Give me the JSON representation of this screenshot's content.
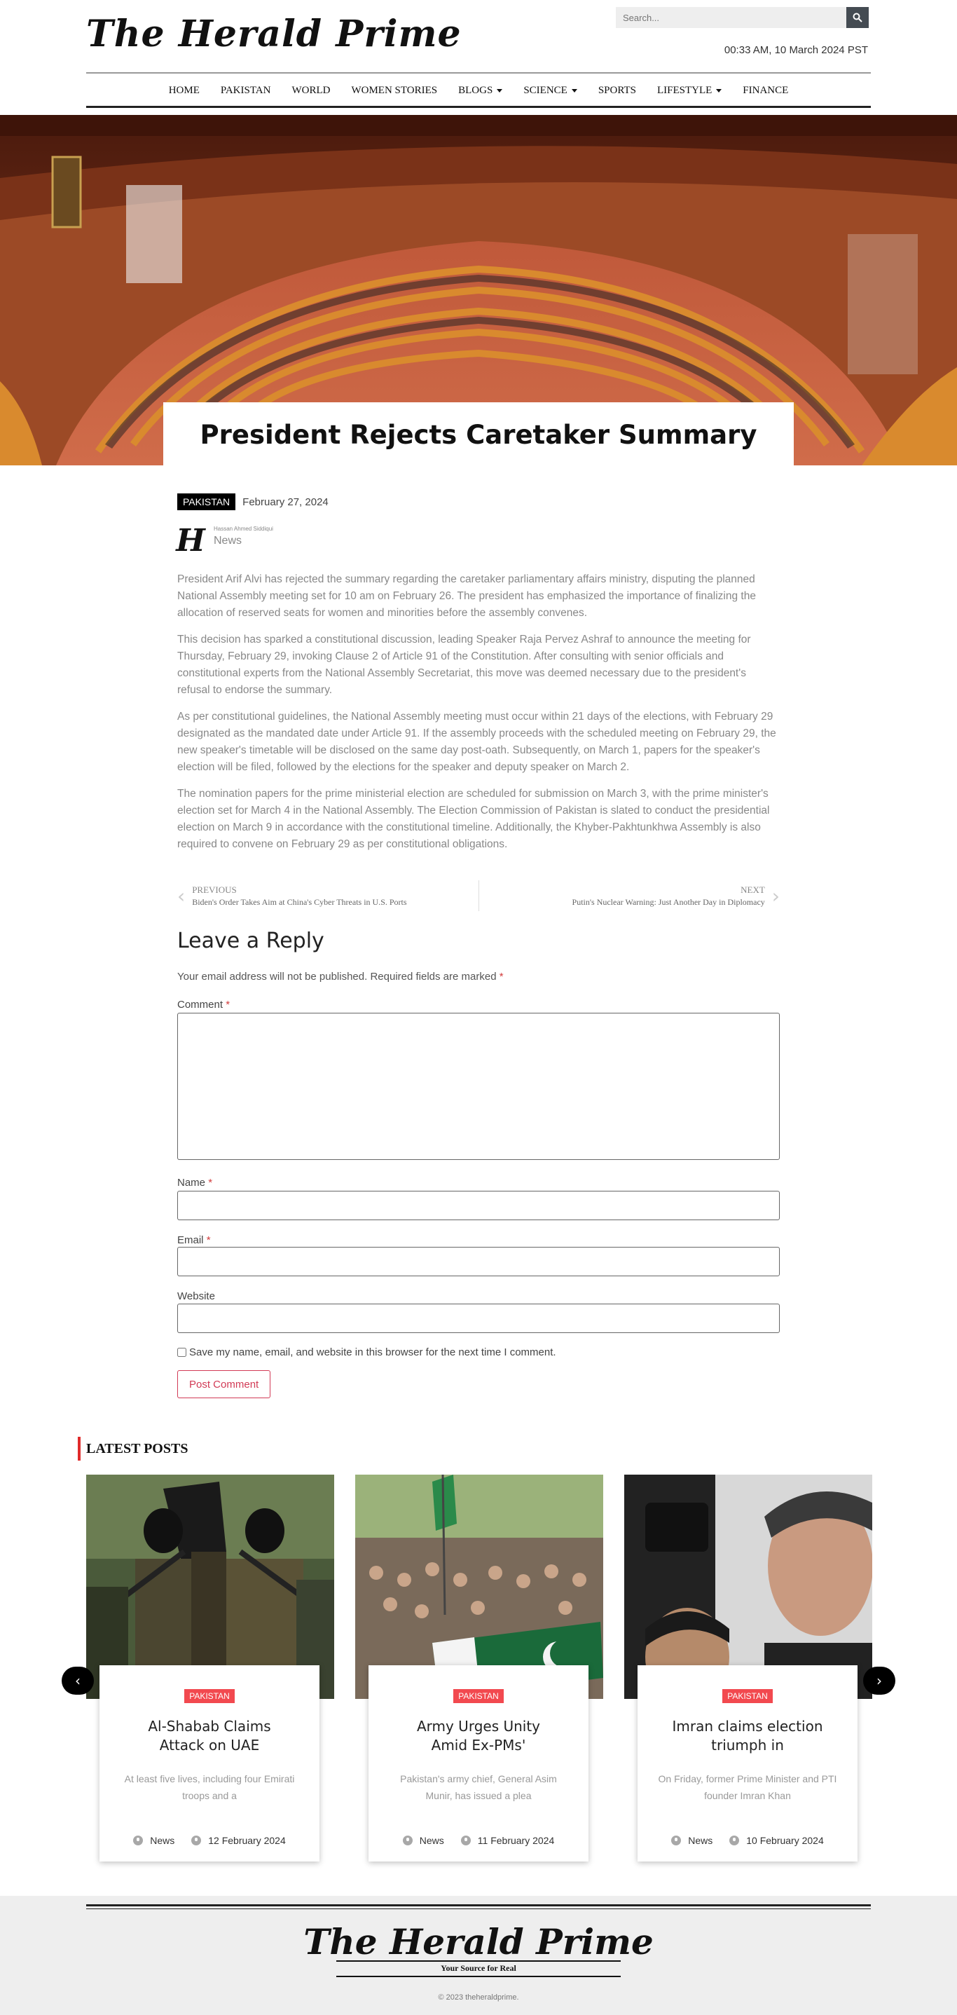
{
  "site": {
    "name": "The Herald Prime",
    "tagline": "Your Source for Real",
    "copyright": "© 2023 theheraldprime."
  },
  "header": {
    "search_placeholder": "Search...",
    "datetime": "00:33 AM, 10 March 2024 PST"
  },
  "nav": {
    "items": [
      {
        "label": "HOME"
      },
      {
        "label": "PAKISTAN"
      },
      {
        "label": "WORLD"
      },
      {
        "label": "WOMEN STORIES"
      },
      {
        "label": "BLOGS"
      },
      {
        "label": "SCIENCE"
      },
      {
        "label": "SPORTS"
      },
      {
        "label": "LIFESTYLE"
      },
      {
        "label": "FINANCE"
      }
    ]
  },
  "article": {
    "title": "President Rejects Caretaker Summary",
    "category": "PAKISTAN",
    "date": "February 27, 2024",
    "author_name": "Hassan Ahmed Siddiqui",
    "author_role": "News",
    "paragraphs": [
      "President Arif Alvi has rejected the summary regarding the caretaker parliamentary affairs ministry, disputing the planned National Assembly meeting set for 10 am on February 26. The president has emphasized the importance of finalizing the allocation of reserved seats for women and minorities before the assembly convenes.",
      "This decision has sparked a constitutional discussion, leading Speaker Raja Pervez Ashraf to announce the meeting for Thursday, February 29, invoking Clause 2 of Article 91 of the Constitution. After consulting with senior officials and constitutional experts from the National Assembly Secretariat, this move was deemed necessary due to the president's refusal to endorse the summary.",
      "As per constitutional guidelines, the National Assembly meeting must occur within 21 days of the elections, with February 29 designated as the mandated date under Article 91. If the assembly proceeds with the scheduled meeting on February 29, the new speaker's timetable will be disclosed on the same day post-oath. Subsequently, on March 1, papers for the speaker's election will be filed, followed by the elections for the speaker and deputy speaker on March 2.",
      "The nomination papers for the prime ministerial election are scheduled for submission on March 3, with the prime minister's election set for March 4 in the National Assembly. The Election Commission of Pakistan is slated to conduct the presidential election on March 9 in accordance with the constitutional timeline. Additionally, the Khyber-Pakhtunkhwa Assembly is also required to convene on February 29 as per constitutional obligations."
    ]
  },
  "post_nav": {
    "prev_label": "PREVIOUS",
    "prev_title": "Biden's Order Takes Aim at China's Cyber Threats in U.S. Ports",
    "next_label": "NEXT",
    "next_title": "Putin's Nuclear Warning: Just Another Day in Diplomacy"
  },
  "reply": {
    "heading": "Leave a Reply",
    "note": "Your email address will not be published.",
    "note_required": "Required fields are marked",
    "required_mark": "*",
    "comment_label": "Comment",
    "name_label": "Name",
    "email_label": "Email",
    "website_label": "Website",
    "save_label": "Save my name, email, and website in this browser for the next time I comment.",
    "submit_label": "Post Comment"
  },
  "latest": {
    "heading": "LATEST POSTS",
    "posts": [
      {
        "category": "PAKISTAN",
        "title": "Al-Shabab Claims Attack on UAE",
        "excerpt": "At least five lives, including four Emirati troops and a",
        "meta_category": "News",
        "date": "12 February 2024"
      },
      {
        "category": "PAKISTAN",
        "title": "Army Urges Unity Amid Ex-PMs'",
        "excerpt": "Pakistan's army chief, General Asim Munir, has issued a plea",
        "meta_category": "News",
        "date": "11 February 2024"
      },
      {
        "category": "PAKISTAN",
        "title": "Imran claims election triumph in",
        "excerpt": "On Friday, former Prime Minister and PTI founder Imran Khan",
        "meta_category": "News",
        "date": "10 February 2024"
      }
    ]
  },
  "colors": {
    "accent_red": "#f2494f",
    "button_pink": "#d23b56",
    "footer_bg": "#eeeeee"
  }
}
